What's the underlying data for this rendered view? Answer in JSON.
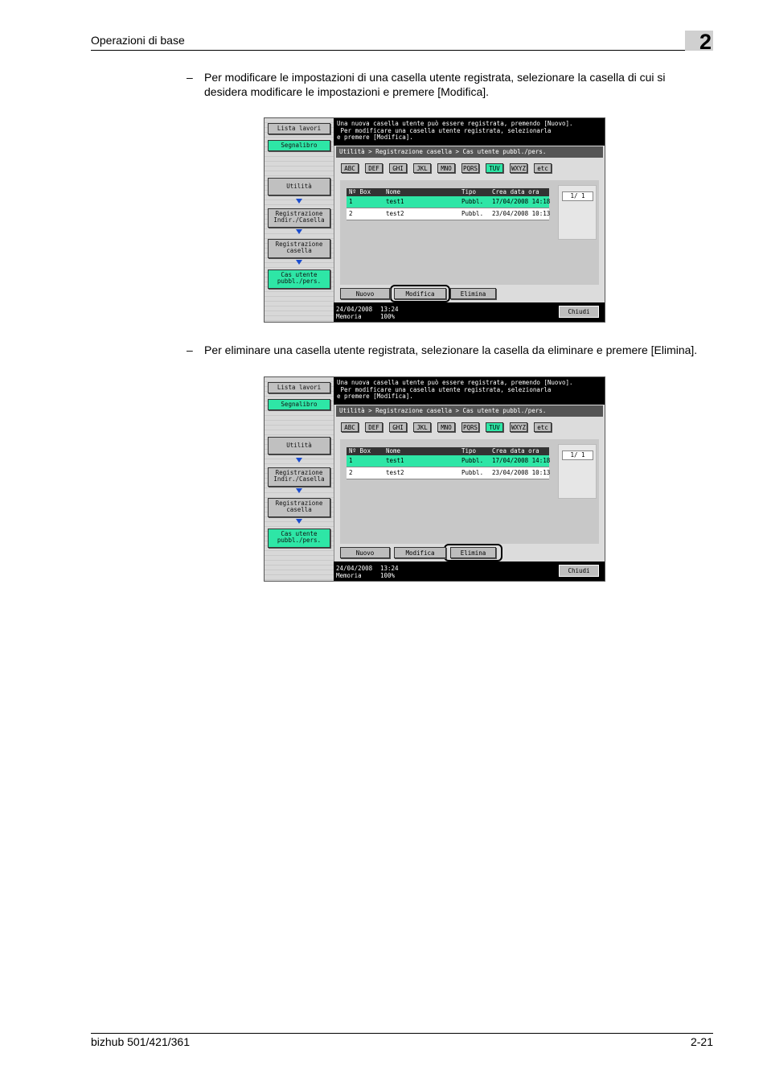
{
  "header": {
    "section_title": "Operazioni di base",
    "chapter_number": "2"
  },
  "instructions": [
    {
      "dash": "–",
      "text": "Per modificare le impostazioni di una casella utente registrata, selezionare la casella di cui si desidera modificare le impostazioni e premere [Modifica]."
    },
    {
      "dash": "–",
      "text": "Per eliminare una casella utente registrata, selezionare la casella da eliminare e premere [Elimina]."
    }
  ],
  "screen": {
    "sidebar": {
      "lista_lavori": "Lista lavori",
      "segnalibro": "Segnalibro",
      "utilita": "Utilità",
      "registrazione_indir": "Registrazione\nIndir./Casella",
      "registrazione_casella": "Registrazione\ncasella",
      "cas_utente": "Cas utente\npubbl./pers."
    },
    "message": "Una nuova casella utente può essere registrata, premendo [Nuovo].\n Per modificare una casella utente registrata, selezionarla\ne premere [Modifica].",
    "breadcrumb": "Utilità > Registrazione casella > Cas utente pubbl./pers.",
    "tabs": [
      "ABC",
      "DEF",
      "GHI",
      "JKL",
      "MNO",
      "PQRS",
      "TUV",
      "WXYZ",
      "etc"
    ],
    "selected_tab": "TUV",
    "table": {
      "headers": [
        "Nº Box",
        "Nome",
        "Tipo",
        "Crea data ora"
      ],
      "rows": [
        {
          "no": "1",
          "name": "test1",
          "type": "Pubbl.",
          "date": "17/04/2008 14:18"
        },
        {
          "no": "2",
          "name": "test2",
          "type": "Pubbl.",
          "date": "23/04/2008 10:13"
        }
      ]
    },
    "page_indicator": "1/   1",
    "buttons": {
      "nuovo": "Nuovo",
      "modifica": "Modifica",
      "elimina": "Elimina",
      "chiudi": "Chiudi"
    },
    "status": {
      "date": "24/04/2008",
      "time": "13:24",
      "memory_label": "Memoria",
      "memory_value": "100%"
    }
  },
  "footer": {
    "model": "bizhub 501/421/361",
    "page": "2-21"
  },
  "colors": {
    "selected_green": "#2ee6a6",
    "arrow_blue": "#1a4ccf"
  }
}
